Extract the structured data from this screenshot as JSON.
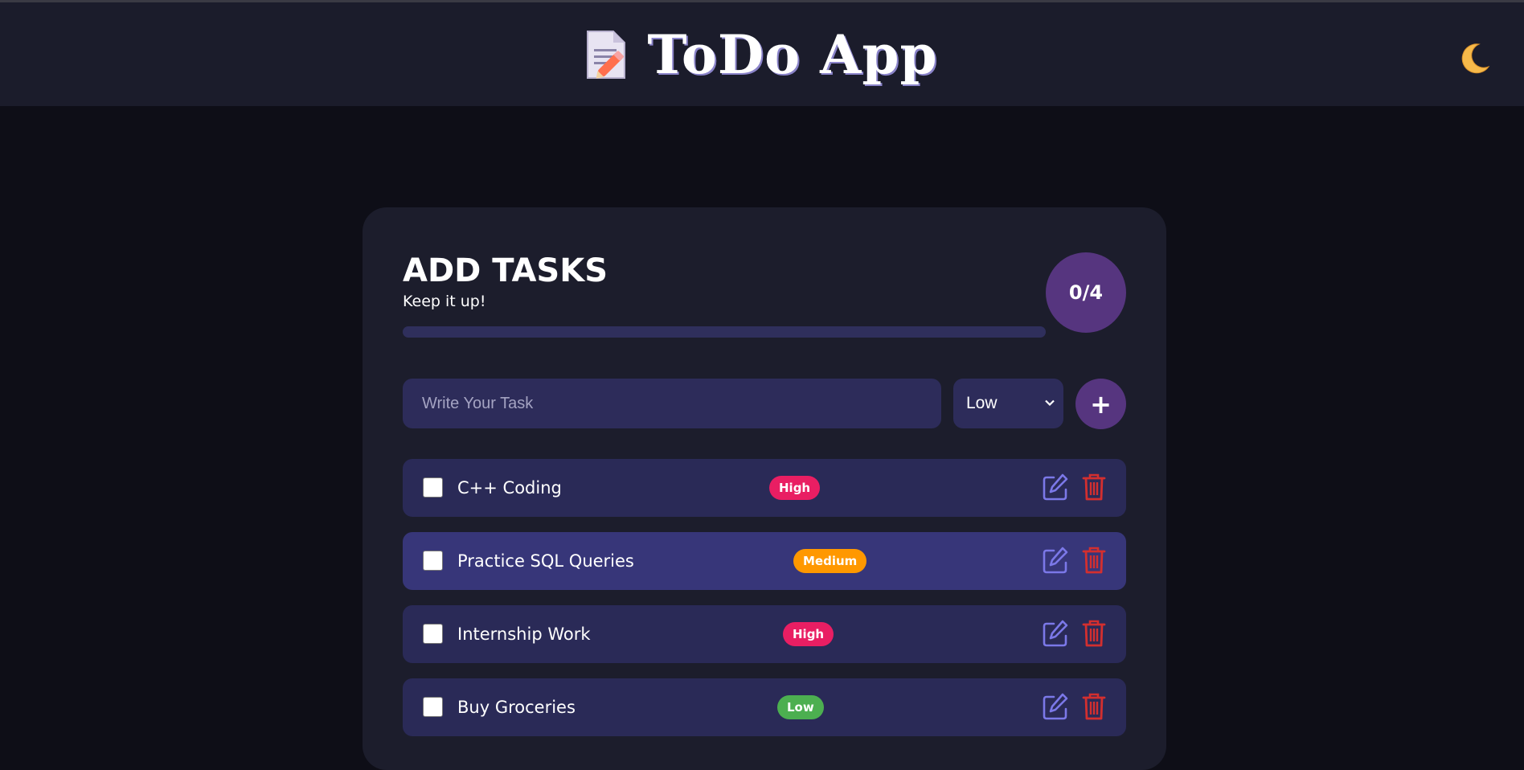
{
  "navbar": {
    "brand_icon": "memo-pencil-icon",
    "title": "ToDo App",
    "theme_icon": "crescent-moon-icon"
  },
  "card": {
    "title": "ADD TASKS",
    "subtitle": "Keep it up!",
    "progress": {
      "completed": 0,
      "total": 4,
      "fraction": 0
    },
    "counter": "0/4"
  },
  "form": {
    "input_placeholder": "Write Your Task",
    "input_value": "",
    "priority_selected": "Low",
    "add_label": "+"
  },
  "tasks": [
    {
      "text": "C++ Coding",
      "priority": "High",
      "checked": false,
      "highlight": false
    },
    {
      "text": "Practice SQL Queries",
      "priority": "Medium",
      "checked": false,
      "highlight": true
    },
    {
      "text": "Internship Work",
      "priority": "High",
      "checked": false,
      "highlight": false
    },
    {
      "text": "Buy Groceries",
      "priority": "Low",
      "checked": false,
      "highlight": false
    }
  ],
  "colors": {
    "background": "#0e0e17",
    "navbar": "#1b1c2b",
    "card": "#1c1d2c",
    "accent": "#56357f",
    "priority_high": "#e91e63",
    "priority_medium": "#ff9800",
    "priority_low": "#4caf50",
    "edit_icon": "#7b78e8",
    "delete_icon": "#d32f2f"
  }
}
